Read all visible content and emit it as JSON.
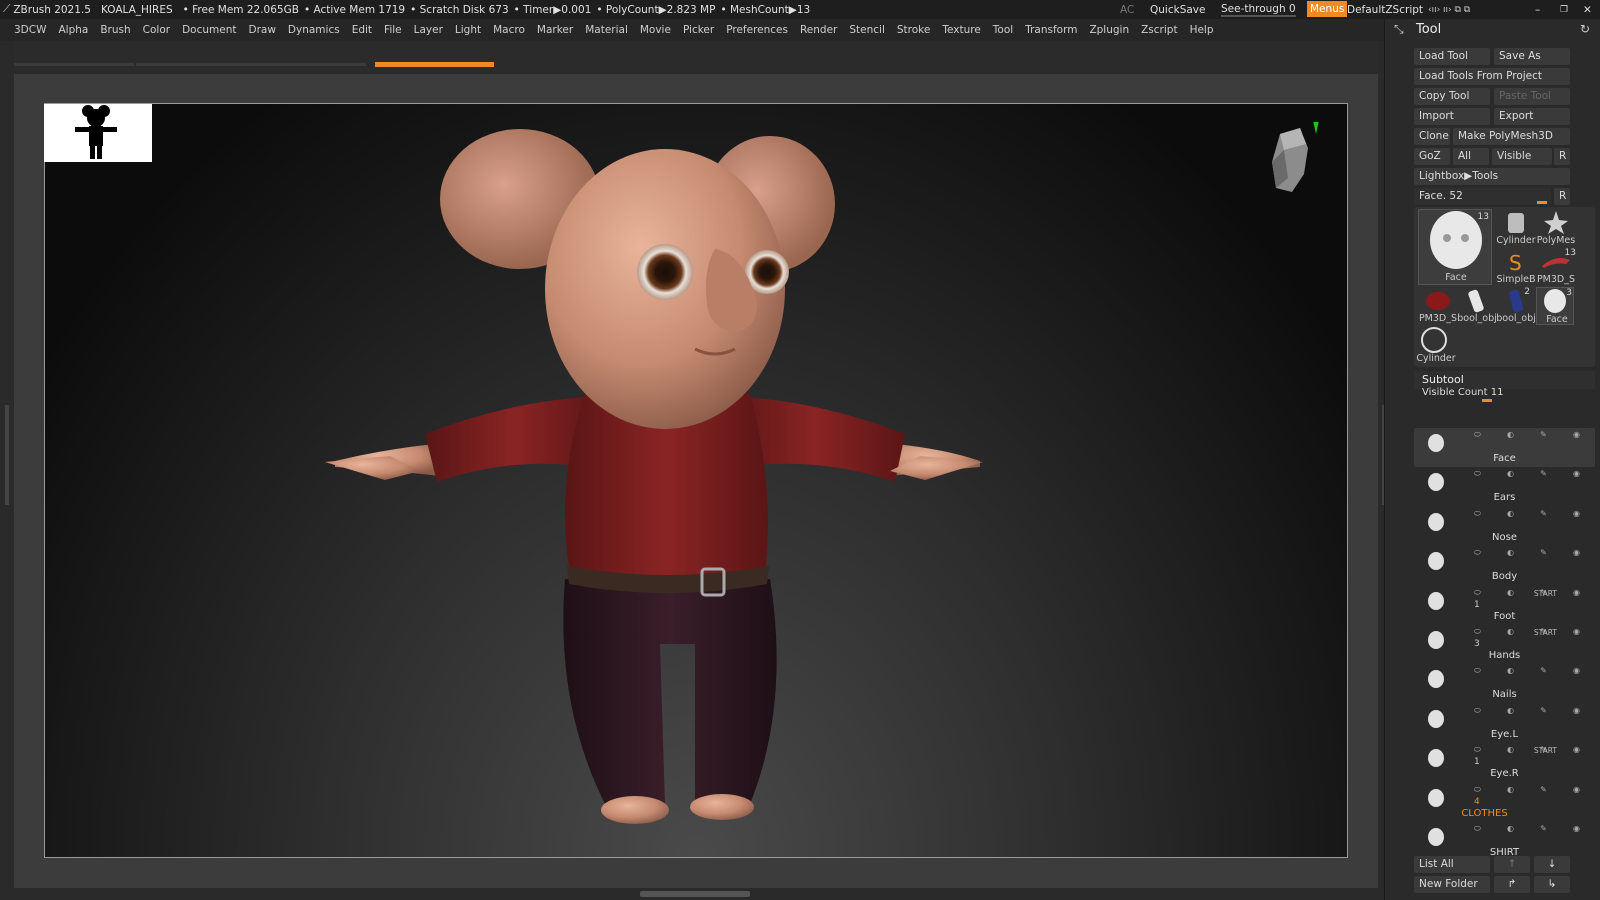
{
  "topbar": {
    "app": "ZBrush 2021.5",
    "project": "KOALA_HIRES",
    "free_mem": "• Free Mem 22.065GB",
    "active_mem": "• Active Mem 1719",
    "scratch": "• Scratch Disk 673",
    "timer": "• Timer▶0.001",
    "polycount": "• PolyCount▶2.823 MP",
    "meshcount": "• MeshCount▶13",
    "ac": "AC",
    "quicksave": "QuickSave",
    "seethrough": "See-through  0",
    "menus": "Menus",
    "script": "DefaultZScript"
  },
  "menu": [
    "3DCW",
    "Alpha",
    "Brush",
    "Color",
    "Document",
    "Draw",
    "Dynamics",
    "Edit",
    "File",
    "Layer",
    "Light",
    "Macro",
    "Marker",
    "Material",
    "Movie",
    "Picker",
    "Preferences",
    "Render",
    "Stencil",
    "Stroke",
    "Texture",
    "Tool",
    "Transform",
    "Zplugin",
    "Zscript",
    "Help"
  ],
  "panel": {
    "title": "Tool",
    "load_tool": "Load Tool",
    "save_as": "Save As",
    "load_from_project": "Load Tools From Project",
    "copy_tool": "Copy Tool",
    "paste_tool": "Paste Tool",
    "import": "Import",
    "export": "Export",
    "clone": "Clone",
    "make_polymesh": "Make PolyMesh3D",
    "goz": "GoZ",
    "all": "All",
    "visible": "Visible",
    "r": "R",
    "lightbox": "Lightbox▶Tools",
    "face_slider": "Face. 52",
    "tools": [
      {
        "label": "Face",
        "count": "13"
      },
      {
        "label": "Cylinder",
        "count": ""
      },
      {
        "label": "PolyMes",
        "count": ""
      },
      {
        "label": "SimpleB",
        "count": ""
      },
      {
        "label": "PM3D_S",
        "count": "13"
      },
      {
        "label": "PM3D_S",
        "count": ""
      },
      {
        "label": "bool_obj",
        "count": ""
      },
      {
        "label": "bool_obj",
        "count": "2"
      },
      {
        "label": "Face",
        "count": "3"
      },
      {
        "label": "Cylinder",
        "count": ""
      }
    ],
    "subtool_title": "Subtool",
    "visible_count": "Visible Count 11",
    "subtools": [
      {
        "name": "Face",
        "start": "",
        "count": ""
      },
      {
        "name": "Ears",
        "start": "",
        "count": ""
      },
      {
        "name": "Nose",
        "start": "",
        "count": ""
      },
      {
        "name": "Body",
        "start": "",
        "count": ""
      },
      {
        "name": "Foot",
        "start": "START",
        "count": "1"
      },
      {
        "name": "Hands",
        "start": "START",
        "count": "3"
      },
      {
        "name": "Nails",
        "start": "",
        "count": ""
      },
      {
        "name": "Eye.L",
        "start": "",
        "count": ""
      },
      {
        "name": "Eye.R",
        "start": "START",
        "count": "1"
      },
      {
        "name": "CLOTHES",
        "start": "",
        "count": "4"
      },
      {
        "name": "SHIRT",
        "start": "",
        "count": ""
      }
    ],
    "list_all": "List All",
    "new_folder": "New Folder"
  },
  "document": {
    "zoom_progress": 0.08
  }
}
